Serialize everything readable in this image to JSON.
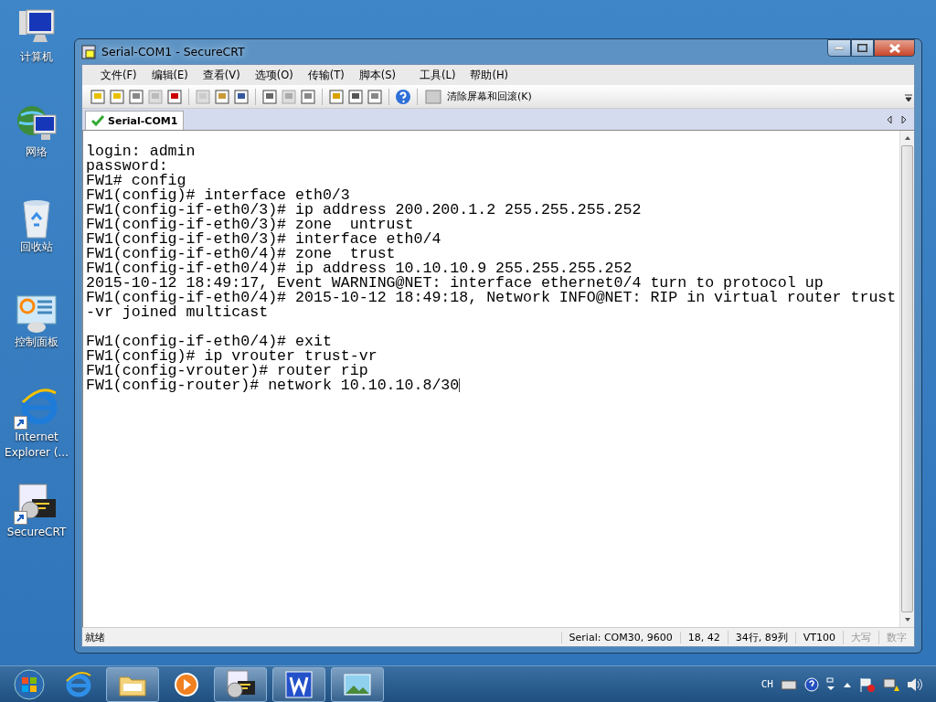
{
  "desktop_icons": [
    {
      "label": "计算机",
      "kind": "computer",
      "shortcut": false
    },
    {
      "label": "网络",
      "kind": "network",
      "shortcut": false
    },
    {
      "label": "回收站",
      "kind": "bin",
      "shortcut": false
    },
    {
      "label": "控制面板",
      "kind": "panel",
      "shortcut": false
    },
    {
      "label": "Internet Explorer (...",
      "kind": "ie",
      "shortcut": true
    },
    {
      "label": "SecureCRT",
      "kind": "crt",
      "shortcut": true
    }
  ],
  "window": {
    "title": "Serial-COM1 - SecureCRT"
  },
  "menu": [
    "文件(F)",
    "编辑(E)",
    "查看(V)",
    "选项(O)",
    "传输(T)",
    "脚本(S)",
    "工具(L)",
    "帮助(H)"
  ],
  "toolbar": {
    "clear_button": "清除屏幕和回滚(K)"
  },
  "tabs": [
    {
      "label": "Serial-COM1",
      "selected": true,
      "connected": true
    }
  ],
  "terminal": {
    "lines": [
      {
        "text": "login: admin"
      },
      {
        "text": "password:"
      },
      {
        "text": "FW1# config"
      },
      {
        "text": "FW1(config)# interface eth0/3"
      },
      {
        "text": "FW1(config-if-eth0/3)# ip address 200.200.1.2 255.255.255.252"
      },
      {
        "text": "FW1(config-if-eth0/3)# zone  untrust"
      },
      {
        "text": "FW1(config-if-eth0/3)# interface eth0/4"
      },
      {
        "text": "FW1(config-if-eth0/4)# zone  trust"
      },
      {
        "text": "FW1(config-if-eth0/4)# ip address 10.10.10.9 255.255.255.252"
      },
      {
        "text": "2015-10-12 18:49:17, Event WARNING@NET: interface ethernet0/4 turn to protocol up"
      },
      {
        "text": "FW1(config-if-eth0/4)# 2015-10-12 18:49:18, Network INFO@NET: RIP in virtual router trust"
      },
      {
        "text": "-vr joined multicast"
      },
      {
        "text": "FW1(config-if-eth0/4)# exit",
        "blank_before": true
      },
      {
        "text": "FW1(config)# ip vrouter trust-vr"
      },
      {
        "text": "FW1(config-vrouter)# router rip"
      },
      {
        "text": "FW1(config-router)# network 10.10.10.8/30",
        "cursor": true
      }
    ]
  },
  "status_bar": [
    {
      "text": "就绪",
      "disabled": false
    },
    {
      "text": "Serial: COM30, 9600",
      "disabled": false
    },
    {
      "text": "18,  42",
      "disabled": false
    },
    {
      "text": "34行, 89列",
      "disabled": false
    },
    {
      "text": "VT100",
      "disabled": false
    },
    {
      "text": "大写",
      "disabled": true
    },
    {
      "text": "数字",
      "disabled": true
    }
  ],
  "taskbar": {
    "items": [
      {
        "kind": "ie"
      },
      {
        "kind": "folder"
      },
      {
        "kind": "media"
      },
      {
        "kind": "crt"
      },
      {
        "kind": "wps"
      },
      {
        "kind": "photo"
      }
    ],
    "language": "CH"
  }
}
